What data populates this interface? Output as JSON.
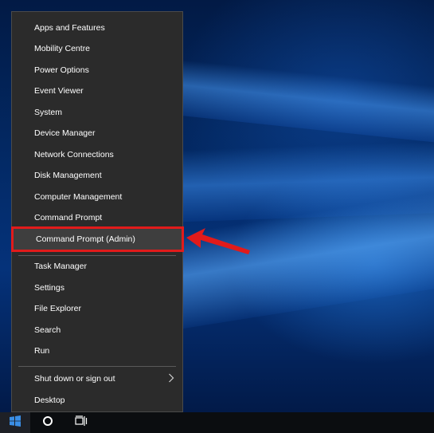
{
  "menu": {
    "items": [
      {
        "label": "Apps and Features"
      },
      {
        "label": "Mobility Centre"
      },
      {
        "label": "Power Options"
      },
      {
        "label": "Event Viewer"
      },
      {
        "label": "System"
      },
      {
        "label": "Device Manager"
      },
      {
        "label": "Network Connections"
      },
      {
        "label": "Disk Management"
      },
      {
        "label": "Computer Management"
      },
      {
        "label": "Command Prompt"
      },
      {
        "label": "Command Prompt (Admin)"
      },
      {
        "label": "Task Manager"
      },
      {
        "label": "Settings"
      },
      {
        "label": "File Explorer"
      },
      {
        "label": "Search"
      },
      {
        "label": "Run"
      },
      {
        "label": "Shut down or sign out"
      },
      {
        "label": "Desktop"
      }
    ]
  },
  "colors": {
    "menu_bg": "#2b2b2b",
    "highlight_outline": "#e11b1b",
    "arrow": "#e11b1b",
    "taskbar": "#0b0d10",
    "start_icon": "#3a8ee6"
  },
  "icons": {
    "start": "windows-logo-icon",
    "cortana": "cortana-circle-icon",
    "task_view": "task-view-icon",
    "submenu": "chevron-right-icon",
    "annotation": "red-arrow-icon"
  }
}
